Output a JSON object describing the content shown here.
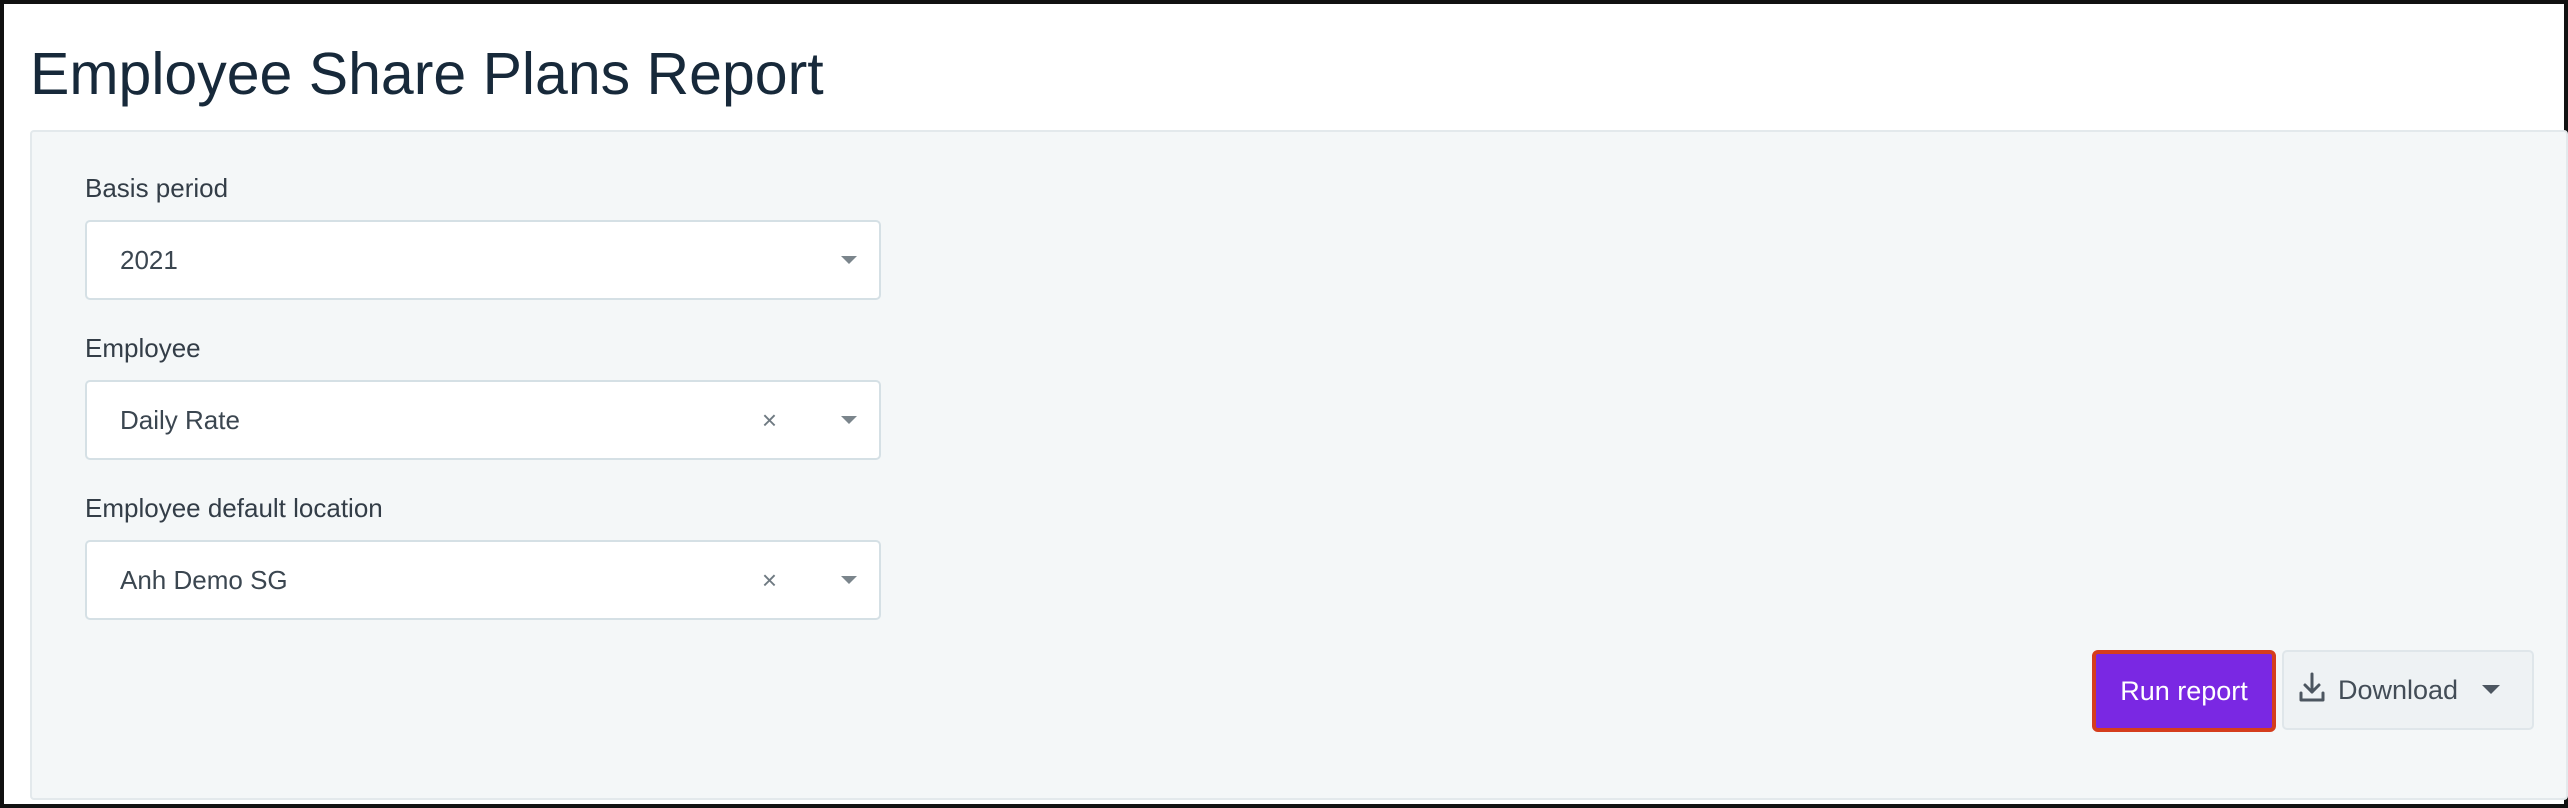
{
  "page": {
    "title": "Employee Share Plans Report"
  },
  "form": {
    "basis_period": {
      "label": "Basis period",
      "value": "2021"
    },
    "employee": {
      "label": "Employee",
      "value": "Daily Rate",
      "clear": "×"
    },
    "location": {
      "label": "Employee default location",
      "value": "Anh Demo SG",
      "clear": "×"
    }
  },
  "actions": {
    "run_label": "Run report",
    "download_label": "Download"
  },
  "icons": {
    "download": "download-icon",
    "caret": "chevron-down-icon",
    "clear": "close-icon"
  },
  "colors": {
    "primary": "#7a28e3",
    "focus_ring": "#d53d1d",
    "panel_bg": "#f4f7f8"
  }
}
